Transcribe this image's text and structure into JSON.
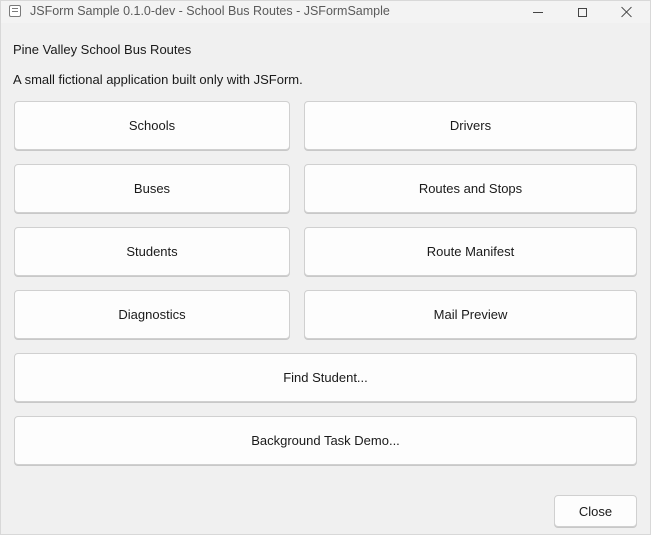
{
  "window": {
    "title": "JSForm Sample 0.1.0-dev - School Bus Routes - JSFormSample",
    "app_icon": "app-window-icon",
    "controls": {
      "minimize": "minimize-icon",
      "maximize": "maximize-icon",
      "close": "close-icon"
    }
  },
  "content": {
    "heading": "Pine Valley School Bus Routes",
    "subtitle": "A small fictional application built only with JSForm."
  },
  "buttons": {
    "schools": "Schools",
    "drivers": "Drivers",
    "buses": "Buses",
    "routes_and_stops": "Routes and Stops",
    "students": "Students",
    "route_manifest": "Route Manifest",
    "diagnostics": "Diagnostics",
    "mail_preview": "Mail Preview",
    "find_student": "Find Student...",
    "background_task_demo": "Background Task Demo...",
    "close": "Close"
  }
}
